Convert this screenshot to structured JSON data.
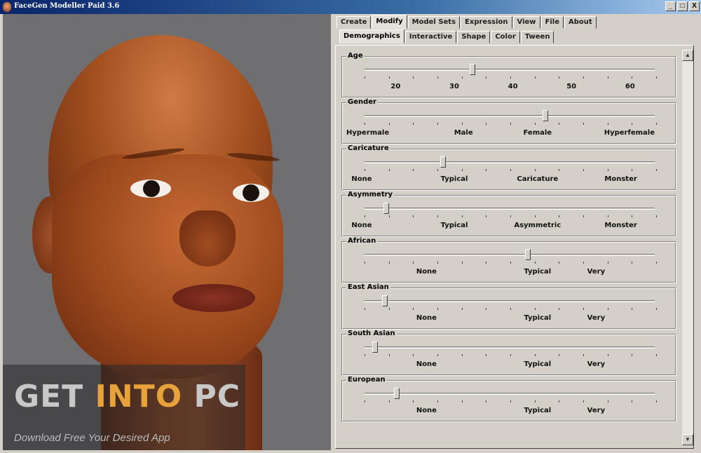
{
  "window": {
    "title": "FaceGen Modeller Paid 3.6",
    "controls": [
      "_",
      "□",
      "X"
    ]
  },
  "watermark": {
    "word1": "GET",
    "word2": "INTO",
    "word3": "PC",
    "subtitle": "Download Free Your Desired App"
  },
  "tabs": {
    "main": [
      "Create",
      "Modify",
      "Model Sets",
      "Expression",
      "View",
      "File",
      "About"
    ],
    "main_active": "Modify",
    "sub": [
      "Demographics",
      "Interactive",
      "Shape",
      "Color",
      "Tween"
    ],
    "sub_active": "Demographics"
  },
  "sliders": [
    {
      "name": "Age",
      "value": 0.37,
      "labels": [
        "20",
        "30",
        "40",
        "50",
        "60"
      ]
    },
    {
      "name": "Gender",
      "value": 0.62,
      "labels": [
        "Hypermale",
        "Male",
        "Female",
        "Hyperfemale"
      ]
    },
    {
      "name": "Caricature",
      "value": 0.27,
      "labels": [
        "None",
        "Typical",
        "Caricature",
        "Monster"
      ]
    },
    {
      "name": "Asymmetry",
      "value": 0.075,
      "labels": [
        "None",
        "Typical",
        "Asymmetric",
        "Monster"
      ]
    },
    {
      "name": "African",
      "value": 0.56,
      "labels": [
        "None",
        "Typical",
        "Very"
      ]
    },
    {
      "name": "East Asian",
      "value": 0.07,
      "labels": [
        "None",
        "Typical",
        "Very"
      ]
    },
    {
      "name": "South Asian",
      "value": 0.035,
      "labels": [
        "None",
        "Typical",
        "Very"
      ]
    },
    {
      "name": "European",
      "value": 0.11,
      "labels": [
        "None",
        "Typical",
        "Very"
      ]
    }
  ]
}
